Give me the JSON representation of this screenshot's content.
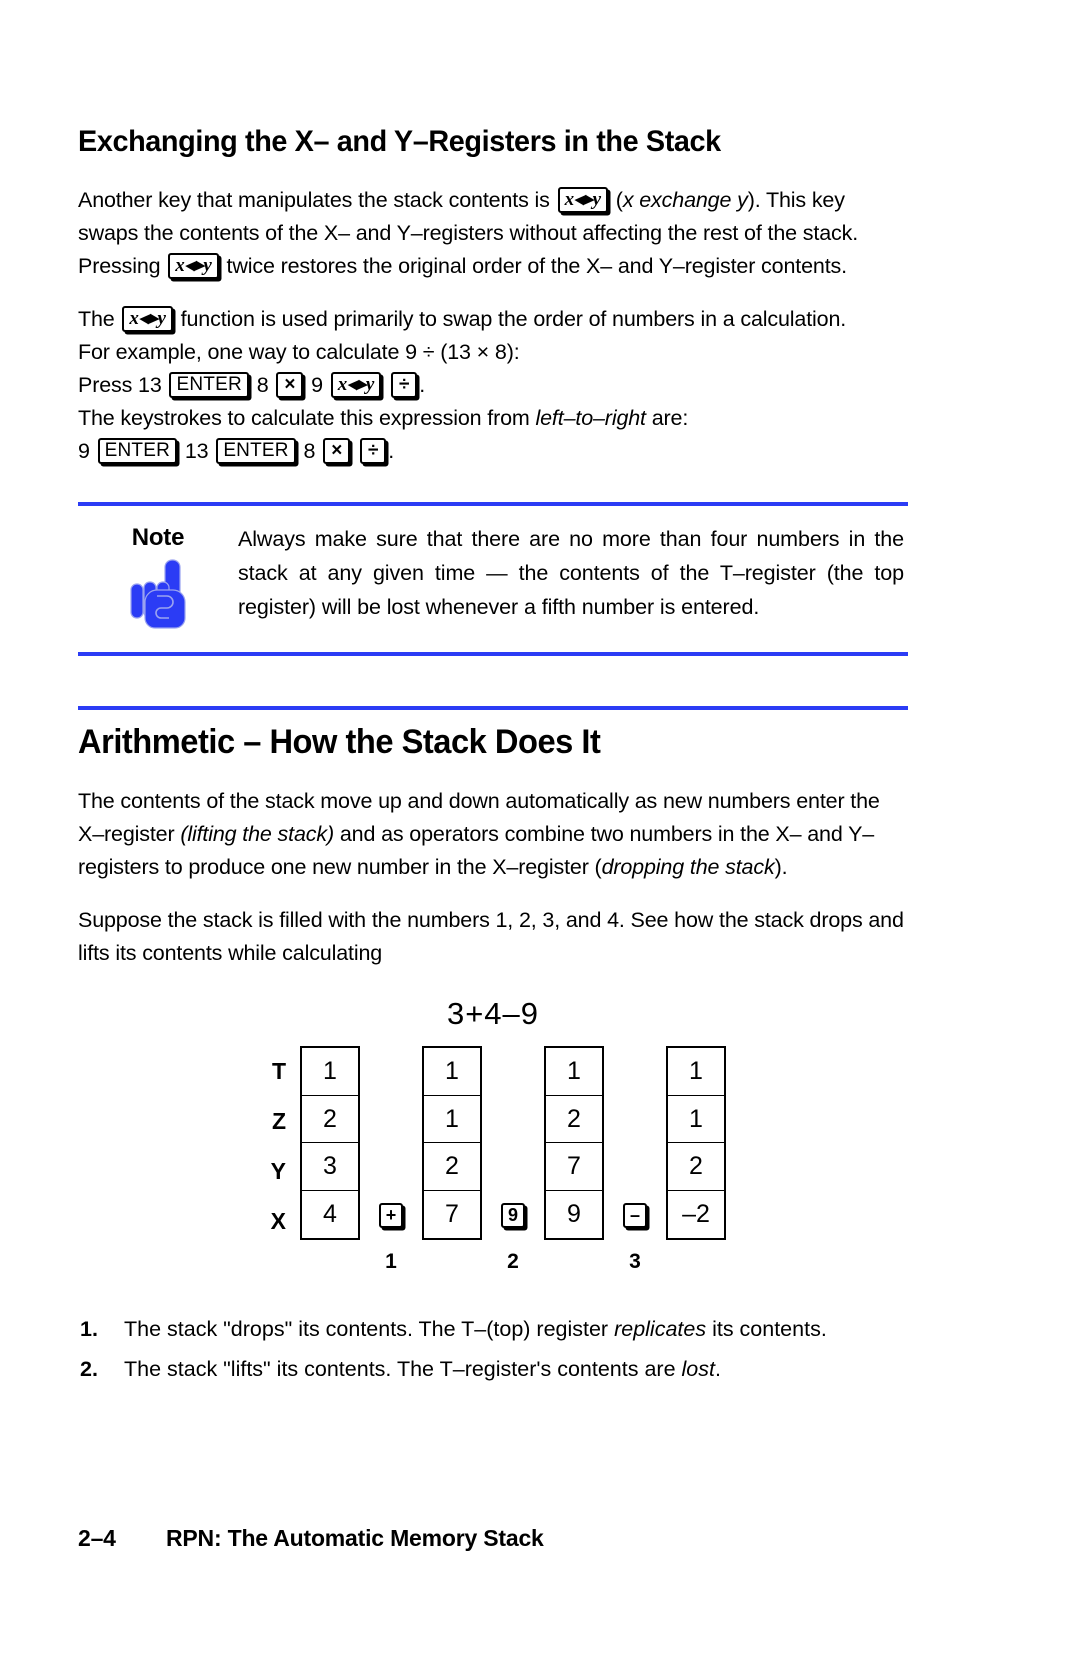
{
  "page": {
    "section_heading": "Exchanging the X– and Y–Registers in the Stack",
    "main_heading": "Arithmetic – How the Stack Does It",
    "accent_color": "#2b3cf5",
    "hand_icon_color": "#2b3cf5"
  },
  "paragraph1": {
    "part1": "Another key that manipulates the stack contents is ",
    "key1": "x◂▸y",
    "part2": " (",
    "italic1": "x exchange y",
    "part3": "). This key swaps the contents of the X– and Y–registers without affecting the rest of the stack. Pressing ",
    "key2": "x◂▸y",
    "part4": " twice restores the original order of the X– and Y–register contents."
  },
  "paragraph2": {
    "part1": "The ",
    "key1": "x◂▸y",
    "part2": " function is used primarily to swap the order of numbers in a calculation.",
    "line2": "For example, one way to calculate 9 ÷ (13 × 8):",
    "line3_pre": "Press 13 ",
    "line3_enter": "ENTER",
    "line3_mid1": " 8 ",
    "line3_times": "×",
    "line3_mid2": " 9 ",
    "line3_xy": "x◂▸y",
    "line3_mid3": " ",
    "line3_div": "÷",
    "line3_end": ".",
    "line4_pre": "The keystrokes to calculate this expression from ",
    "line4_italic": "left–to–right",
    "line4_post": " are:",
    "line5_pre": "9 ",
    "line5_enter1": "ENTER",
    "line5_mid1": " 13 ",
    "line5_enter2": "ENTER",
    "line5_mid2": " 8 ",
    "line5_times": "×",
    "line5_mid3": " ",
    "line5_div": "÷",
    "line5_end": "."
  },
  "note": {
    "label": "Note",
    "text": "Always make sure that there are no more than four numbers in the stack at any given time — the contents of the T–register (the top register) will be lost whenever a fifth number is entered."
  },
  "arith": {
    "para1_a": "The contents of the stack move up and down automatically as new numbers enter the X–register ",
    "para1_italic1": "(lifting the stack)",
    "para1_b": " and as operators combine two numbers in the X– and Y–registers to produce one new number in the X–register (",
    "para1_italic2": "dropping the stack",
    "para1_c": ").",
    "para2": "Suppose the stack is filled with the numbers 1, 2, 3, and 4. See how the stack drops and lifts its contents while calculating",
    "equation": "3+4–9"
  },
  "chart_data": {
    "type": "table",
    "title": "RPN stack evolution for 3+4–9",
    "row_labels": [
      "T",
      "Z",
      "Y",
      "X"
    ],
    "columns": [
      {
        "values": [
          "1",
          "2",
          "3",
          "4"
        ]
      },
      {
        "values": [
          "1",
          "1",
          "2",
          "7"
        ]
      },
      {
        "values": [
          "1",
          "2",
          "7",
          "9"
        ]
      },
      {
        "values": [
          "1",
          "1",
          "2",
          "–2"
        ]
      }
    ],
    "operators": [
      {
        "key": "+",
        "step": "1"
      },
      {
        "key": "9",
        "step": "2"
      },
      {
        "key": "–",
        "step": "3"
      }
    ]
  },
  "footnotes": [
    {
      "num": "1.",
      "pre": "The stack \"drops\" its contents. The T–(top) register ",
      "italic": "replicates",
      "post": " its contents."
    },
    {
      "num": "2.",
      "pre": "The stack \"lifts\" its contents. The T–register's contents are ",
      "italic": "lost",
      "post": "."
    }
  ],
  "footer": {
    "page_number": "2–4",
    "title": "RPN: The Automatic Memory Stack"
  }
}
